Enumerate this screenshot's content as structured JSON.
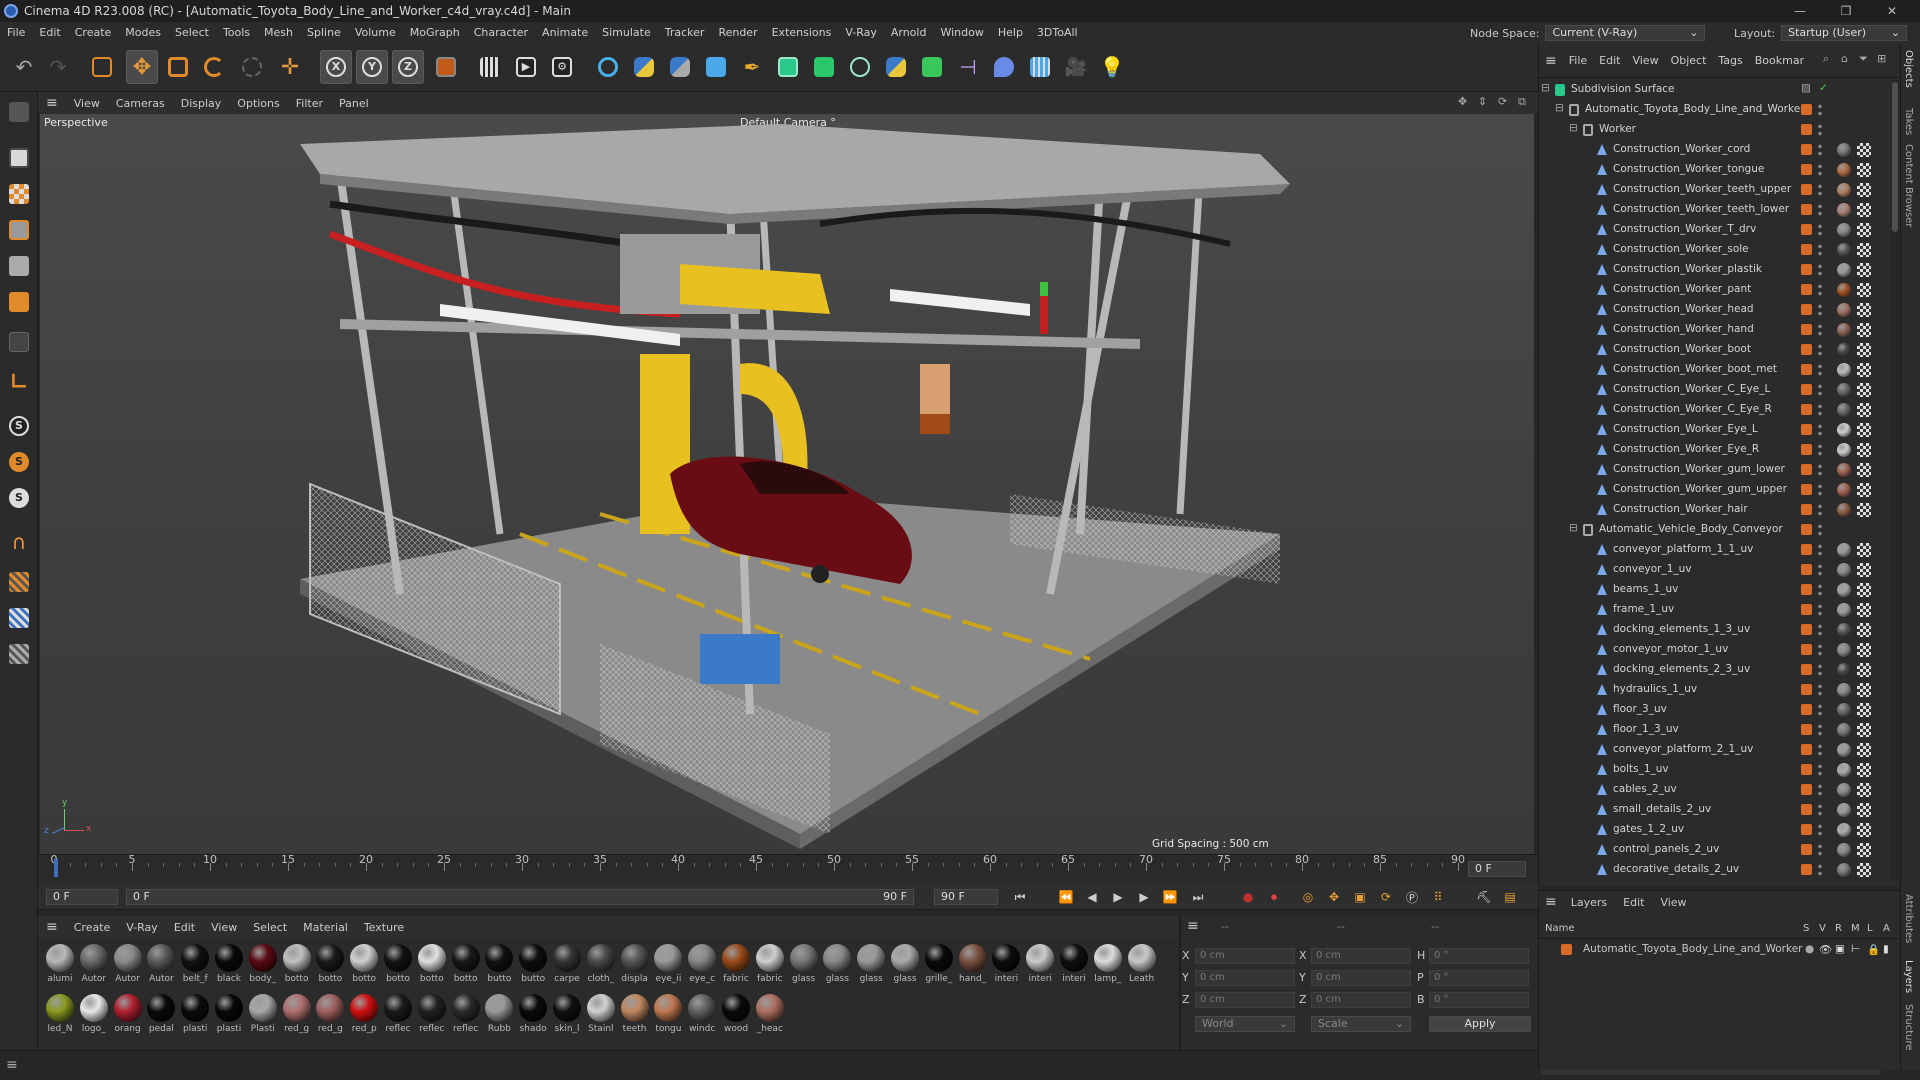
{
  "titlebar": {
    "title": "Cinema 4D R23.008 (RC) - [Automatic_Toyota_Body_Line_and_Worker_c4d_vray.c4d] - Main",
    "minimize": "—",
    "restore": "❐",
    "close": "✕"
  },
  "menubar": {
    "items": [
      "File",
      "Edit",
      "Create",
      "Modes",
      "Select",
      "Tools",
      "Mesh",
      "Spline",
      "Volume",
      "MoGraph",
      "Character",
      "Animate",
      "Simulate",
      "Tracker",
      "Render",
      "Extensions",
      "V-Ray",
      "Arnold",
      "Window",
      "Help",
      "3DToAll"
    ],
    "node_space_label": "Node Space:",
    "node_space_value": "Current (V-Ray)",
    "layout_label": "Layout:",
    "layout_value": "Startup (User)"
  },
  "viewport_menu": {
    "items": [
      "View",
      "Cameras",
      "Display",
      "Options",
      "Filter",
      "Panel"
    ]
  },
  "viewport": {
    "view_name": "Perspective",
    "camera": "Default Camera",
    "camera_suffix": "°",
    "grid_spacing": "Grid Spacing : 500 cm",
    "axis_x": "x",
    "axis_y": "y",
    "axis_z": "z"
  },
  "timeline": {
    "ticks": [
      "0",
      "5",
      "10",
      "15",
      "20",
      "25",
      "30",
      "35",
      "40",
      "45",
      "50",
      "55",
      "60",
      "65",
      "70",
      "75",
      "80",
      "85",
      "90"
    ],
    "current_frame": "0 F"
  },
  "transport": {
    "start_field": "0 F",
    "current_field": "0 F",
    "end_field": "90 F",
    "end_field2": "90 F"
  },
  "material_menu": {
    "items": [
      "Create",
      "V-Ray",
      "Edit",
      "View",
      "Select",
      "Material",
      "Texture"
    ]
  },
  "materials": [
    {
      "label": "alumi",
      "color": "#b8b8b8"
    },
    {
      "label": "Autor",
      "color": "#6a6a6a"
    },
    {
      "label": "Autor",
      "color": "#8a8a8a"
    },
    {
      "label": "Autor",
      "color": "#5a5a5a"
    },
    {
      "label": "belt_f",
      "color": "#111111"
    },
    {
      "label": "black",
      "color": "#0a0a0a"
    },
    {
      "label": "body_",
      "color": "#5a0a12"
    },
    {
      "label": "botto",
      "color": "#c0c0c0"
    },
    {
      "label": "botto",
      "color": "#1a1a1a"
    },
    {
      "label": "botto",
      "color": "#d0d0d0"
    },
    {
      "label": "botto",
      "color": "#141414"
    },
    {
      "label": "botto",
      "color": "#e0e0e0"
    },
    {
      "label": "botto",
      "color": "#181818"
    },
    {
      "label": "butto",
      "color": "#111111"
    },
    {
      "label": "butto",
      "color": "#0e0e0e"
    },
    {
      "label": "carpe",
      "color": "#333333"
    },
    {
      "label": "cloth_",
      "color": "#4a4a4a"
    },
    {
      "label": "displa",
      "color": "#555555"
    },
    {
      "label": "eye_ii",
      "color": "#9a9a9a"
    },
    {
      "label": "eye_c",
      "color": "#888888"
    },
    {
      "label": "fabric",
      "color": "#9a4a1a"
    },
    {
      "label": "fabric",
      "color": "#cfcfcf"
    },
    {
      "label": "glass",
      "color": "#777777"
    },
    {
      "label": "glass",
      "color": "#8a8a8a"
    },
    {
      "label": "glass",
      "color": "#999999"
    },
    {
      "label": "glass",
      "color": "#aaaaaa"
    },
    {
      "label": "grille_",
      "color": "#0a0a0a"
    },
    {
      "label": "hand_",
      "color": "#7a5040"
    },
    {
      "label": "interi",
      "color": "#0c0c0c"
    },
    {
      "label": "interi",
      "color": "#cccccc"
    },
    {
      "label": "interi",
      "color": "#0f0f0f"
    },
    {
      "label": "lamp_",
      "color": "#dddddd"
    },
    {
      "label": "Leath",
      "color": "#c8c8c8"
    },
    {
      "label": "led_N",
      "color": "#8a9a20"
    },
    {
      "label": "logo_",
      "color": "#e8e8e8"
    },
    {
      "label": "orang",
      "color": "#b02030"
    },
    {
      "label": "pedal",
      "color": "#0a0a0a"
    },
    {
      "label": "plasti",
      "color": "#0c0c0c"
    },
    {
      "label": "plasti",
      "color": "#080808"
    },
    {
      "label": "Plasti",
      "color": "#a8a8a8"
    },
    {
      "label": "red_g",
      "color": "#b07070"
    },
    {
      "label": "red_g",
      "color": "#a06060"
    },
    {
      "label": "red_p",
      "color": "#d01010"
    },
    {
      "label": "reflec",
      "color": "#1a1a1a"
    },
    {
      "label": "reflec",
      "color": "#222222"
    },
    {
      "label": "reflec",
      "color": "#2a2a2a"
    },
    {
      "label": "Rubb",
      "color": "#999999"
    },
    {
      "label": "shado",
      "color": "#0a0a0a"
    },
    {
      "label": "skin_l",
      "color": "#101010"
    },
    {
      "label": "Stainl",
      "color": "#d0d0d0"
    },
    {
      "label": "teeth",
      "color": "#c08860"
    },
    {
      "label": "tongu",
      "color": "#c07850"
    },
    {
      "label": "windc",
      "color": "#606060"
    },
    {
      "label": "wood",
      "color": "#0a0a0a"
    },
    {
      "label": "_heac",
      "color": "#b07060"
    }
  ],
  "coords": {
    "x_label": "X",
    "y_label": "Y",
    "z_label": "Z",
    "x2_label": "X",
    "y2_label": "Y",
    "z2_label": "Z",
    "h_label": "H",
    "p_label": "P",
    "b_label": "B",
    "x": "0 cm",
    "y": "0 cm",
    "z": "0 cm",
    "x2": "0 cm",
    "y2": "0 cm",
    "z2": "0 cm",
    "h": "0 °",
    "p": "0 °",
    "b": "0 °",
    "space": "World",
    "mode": "Scale",
    "apply": "Apply",
    "dash1": "--",
    "dash2": "--",
    "dash3": "--"
  },
  "objects_menu": {
    "items": [
      "File",
      "Edit",
      "View",
      "Object",
      "Tags",
      "Bookmar"
    ]
  },
  "objects": [
    {
      "name": "Subdivision Surface",
      "indent": 0,
      "type": "subdiv",
      "tag": false
    },
    {
      "name": "Automatic_Toyota_Body_Line_and_Worker",
      "indent": 1,
      "type": "null",
      "tag": true
    },
    {
      "name": "Worker",
      "indent": 2,
      "type": "null",
      "tag": true
    },
    {
      "name": "Construction_Worker_cord",
      "indent": 3,
      "type": "poly",
      "tag": true,
      "mat": "#777777"
    },
    {
      "name": "Construction_Worker_tongue",
      "indent": 3,
      "type": "poly",
      "tag": true,
      "mat": "#b06a40"
    },
    {
      "name": "Construction_Worker_teeth_upper",
      "indent": 3,
      "type": "poly",
      "tag": true,
      "mat": "#b08060"
    },
    {
      "name": "Construction_Worker_teeth_lower",
      "indent": 3,
      "type": "poly",
      "tag": true,
      "mat": "#a88070"
    },
    {
      "name": "Construction_Worker_T_drv",
      "indent": 3,
      "type": "poly",
      "tag": true,
      "mat": "#888888"
    },
    {
      "name": "Construction_Worker_sole",
      "indent": 3,
      "type": "poly",
      "tag": true,
      "mat": "#555555"
    },
    {
      "name": "Construction_Worker_plastik",
      "indent": 3,
      "type": "poly",
      "tag": true,
      "mat": "#999999"
    },
    {
      "name": "Construction_Worker_pant",
      "indent": 3,
      "type": "poly",
      "tag": true,
      "mat": "#a05020"
    },
    {
      "name": "Construction_Worker_head",
      "indent": 3,
      "type": "poly",
      "tag": true,
      "mat": "#a07060"
    },
    {
      "name": "Construction_Worker_hand",
      "indent": 3,
      "type": "poly",
      "tag": true,
      "mat": "#8a6050"
    },
    {
      "name": "Construction_Worker_boot",
      "indent": 3,
      "type": "poly",
      "tag": true,
      "mat": "#444444"
    },
    {
      "name": "Construction_Worker_boot_met",
      "indent": 3,
      "type": "poly",
      "tag": true,
      "mat": "#bbbbbb"
    },
    {
      "name": "Construction_Worker_C_Eye_L",
      "indent": 3,
      "type": "poly",
      "tag": true,
      "mat": "#666666"
    },
    {
      "name": "Construction_Worker_C_Eye_R",
      "indent": 3,
      "type": "poly",
      "tag": true,
      "mat": "#666666"
    },
    {
      "name": "Construction_Worker_Eye_L",
      "indent": 3,
      "type": "poly",
      "tag": true,
      "mat": "#cccccc"
    },
    {
      "name": "Construction_Worker_Eye_R",
      "indent": 3,
      "type": "poly",
      "tag": true,
      "mat": "#cccccc"
    },
    {
      "name": "Construction_Worker_gum_lower",
      "indent": 3,
      "type": "poly",
      "tag": true,
      "mat": "#a06050"
    },
    {
      "name": "Construction_Worker_gum_upper",
      "indent": 3,
      "type": "poly",
      "tag": true,
      "mat": "#a06050"
    },
    {
      "name": "Construction_Worker_hair",
      "indent": 3,
      "type": "poly",
      "tag": true,
      "mat": "#8a5a40"
    },
    {
      "name": "Automatic_Vehicle_Body_Conveyor",
      "indent": 2,
      "type": "null",
      "tag": true
    },
    {
      "name": "conveyor_platform_1_1_uv",
      "indent": 3,
      "type": "poly",
      "tag": true,
      "mat": "#9a9a9a"
    },
    {
      "name": "conveyor_1_uv",
      "indent": 3,
      "type": "poly",
      "tag": true,
      "mat": "#8a8a8a"
    },
    {
      "name": "beams_1_uv",
      "indent": 3,
      "type": "poly",
      "tag": true,
      "mat": "#a0a0a0"
    },
    {
      "name": "frame_1_uv",
      "indent": 3,
      "type": "poly",
      "tag": true,
      "mat": "#9a9a9a"
    },
    {
      "name": "docking_elements_1_3_uv",
      "indent": 3,
      "type": "poly",
      "tag": true,
      "mat": "#555555"
    },
    {
      "name": "conveyor_motor_1_uv",
      "indent": 3,
      "type": "poly",
      "tag": true,
      "mat": "#888888"
    },
    {
      "name": "docking_elements_2_3_uv",
      "indent": 3,
      "type": "poly",
      "tag": true,
      "mat": "#444444"
    },
    {
      "name": "hydraulics_1_uv",
      "indent": 3,
      "type": "poly",
      "tag": true,
      "mat": "#8a8a8a"
    },
    {
      "name": "floor_3_uv",
      "indent": 3,
      "type": "poly",
      "tag": true,
      "mat": "#666666"
    },
    {
      "name": "floor_1_3_uv",
      "indent": 3,
      "type": "poly",
      "tag": true,
      "mat": "#777777"
    },
    {
      "name": "conveyor_platform_2_1_uv",
      "indent": 3,
      "type": "poly",
      "tag": true,
      "mat": "#999999"
    },
    {
      "name": "bolts_1_uv",
      "indent": 3,
      "type": "poly",
      "tag": true,
      "mat": "#aaaaaa"
    },
    {
      "name": "cables_2_uv",
      "indent": 3,
      "type": "poly",
      "tag": true,
      "mat": "#888888"
    },
    {
      "name": "small_details_2_uv",
      "indent": 3,
      "type": "poly",
      "tag": true,
      "mat": "#999999"
    },
    {
      "name": "gates_1_2_uv",
      "indent": 3,
      "type": "poly",
      "tag": true,
      "mat": "#aaaaaa"
    },
    {
      "name": "control_panels_2_uv",
      "indent": 3,
      "type": "poly",
      "tag": true,
      "mat": "#888888"
    },
    {
      "name": "decorative_details_2_uv",
      "indent": 3,
      "type": "poly",
      "tag": true,
      "mat": "#777777"
    }
  ],
  "layers_menu": {
    "items": [
      "Layers",
      "Edit",
      "View"
    ]
  },
  "layers_header": {
    "name": "Name",
    "cols": [
      "S",
      "V",
      "R",
      "M",
      "L",
      "A"
    ]
  },
  "layers": [
    {
      "name": "Automatic_Toyota_Body_Line_and_Worker"
    }
  ],
  "right_tabs": [
    "Objects",
    "Takes",
    "Content Browser",
    "Attributes",
    "Layers",
    "Structure"
  ],
  "colors": {
    "accent": "#d96a2a",
    "selection_blue": "#3a70c0"
  }
}
